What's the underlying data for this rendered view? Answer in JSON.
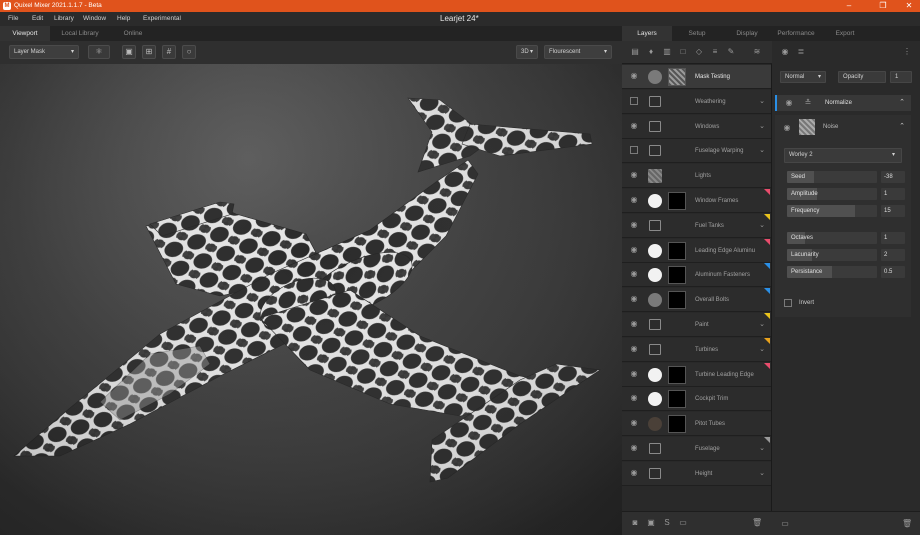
{
  "window": {
    "title": "Quixel Mixer 2021.1.1.7 - Beta",
    "doc_title": "Learjet 24*"
  },
  "menu": [
    "File",
    "Edit",
    "Library",
    "Window",
    "Help",
    "Experimental"
  ],
  "left_tabs": [
    "Viewport",
    "Local Library",
    "Online"
  ],
  "right_tabs": [
    "Layers",
    "Setup",
    "Display",
    "Performance",
    "Export"
  ],
  "toolbar": {
    "layer_mode": "Layer Mask",
    "view_mode": "3D",
    "lighting": "Flourescent"
  },
  "layers": [
    {
      "name": "Mask Testing",
      "kind": "layer",
      "visible": "eye",
      "flag": "",
      "selected": true
    },
    {
      "name": "Weathering",
      "kind": "folder",
      "visible": "off",
      "flag": ""
    },
    {
      "name": "Windows",
      "kind": "folder",
      "visible": "eye",
      "flag": ""
    },
    {
      "name": "Fuselage Warping",
      "kind": "folder",
      "visible": "off",
      "flag": ""
    },
    {
      "name": "Lights",
      "kind": "layer",
      "visible": "eye",
      "flag": ""
    },
    {
      "name": "Window Frames",
      "kind": "layer",
      "visible": "eye",
      "flag": "#e84c6c"
    },
    {
      "name": "Fuel Tanks",
      "kind": "folder",
      "visible": "eye",
      "flag": "#e8c21c"
    },
    {
      "name": "Leading Edge Aluminu",
      "kind": "layer",
      "visible": "eye",
      "flag": "#e84c6c"
    },
    {
      "name": "Aluminum Fasteners",
      "kind": "layer",
      "visible": "eye",
      "flag": "#2a8fe6"
    },
    {
      "name": "Overall Bolts",
      "kind": "layer",
      "visible": "eye",
      "flag": "#2a8fe6"
    },
    {
      "name": "Paint",
      "kind": "folder",
      "visible": "eye",
      "flag": "#e8c21c"
    },
    {
      "name": "Turbines",
      "kind": "folder",
      "visible": "eye",
      "flag": "#e8a21c"
    },
    {
      "name": "Turbine Leading Edge",
      "kind": "layer",
      "visible": "eye",
      "flag": "#e84c6c"
    },
    {
      "name": "Cockpit Trim",
      "kind": "layer",
      "visible": "eye",
      "flag": ""
    },
    {
      "name": "Pitot Tubes",
      "kind": "layer",
      "visible": "eye",
      "flag": ""
    },
    {
      "name": "Fuselage",
      "kind": "folder",
      "visible": "eye",
      "flag": "#9a9a9a"
    },
    {
      "name": "Height",
      "kind": "folder",
      "visible": "eye",
      "flag": ""
    }
  ],
  "props": {
    "blend_mode": "Normal",
    "opacity_label": "Opacity",
    "opacity_value": "1",
    "modifier": "Normalize",
    "noise_label": "Noise",
    "noise_type": "Worley 2",
    "params": [
      {
        "label": "Seed",
        "value": "-38",
        "fill": 0.3
      },
      {
        "label": "Amplitude",
        "value": "1",
        "fill": 0.33
      },
      {
        "label": "Frequency",
        "value": "15",
        "fill": 0.75
      },
      {
        "label": "Octaves",
        "value": "1",
        "fill": 0.2
      },
      {
        "label": "Lacunarity",
        "value": "2",
        "fill": 0.28
      },
      {
        "label": "Persistance",
        "value": "0.5",
        "fill": 0.5
      }
    ],
    "invert_label": "Invert"
  }
}
